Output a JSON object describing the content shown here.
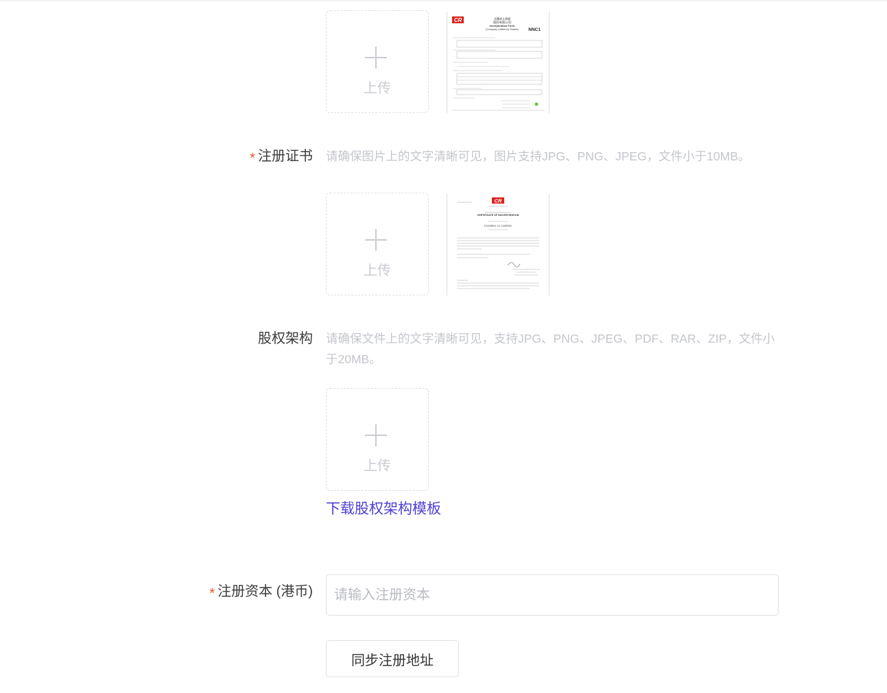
{
  "upload_label": "上传",
  "form1": {
    "thumb_title_cn": "法團成立表格",
    "thumb_subtitle": "(股份有限公司)",
    "thumb_title_en": "Incorporation Form",
    "thumb_sub_en": "(Company Limited by Shares)",
    "thumb_form_no": "NNC1"
  },
  "reg_cert": {
    "label": "注册证书",
    "required_mark": "*",
    "hint": "请确保图片上的文字清晰可见，图片支持JPG、PNG、JPEG，文件小于10MB。",
    "thumb_logo": "CR",
    "thumb_title": "CERTIFICATE OF INCORPORATION",
    "thumb_company": "EXAMPLE CO. LIMITED"
  },
  "equity": {
    "label": "股权架构",
    "hint": "请确保文件上的文字清晰可见，支持JPG、PNG、JPEG、PDF、RAR、ZIP，文件小于20MB。",
    "download_link": "下载股权架构模板"
  },
  "capital": {
    "label": "注册资本 (港币)",
    "required_mark": "*",
    "placeholder": "请输入注册资本",
    "value": ""
  },
  "sync_button": "同步注册地址",
  "colors": {
    "required": "#e8542e",
    "link": "#4e3fd6",
    "hint": "#c4c6cc"
  }
}
